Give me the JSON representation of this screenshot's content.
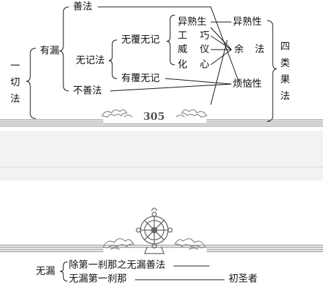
{
  "page_top": {
    "root_label": "一切法",
    "branches": {
      "good": "善法",
      "outflow": "有漏",
      "neutral": "无记法",
      "unobscured": "无覆无记",
      "obscured": "有覆无记",
      "unwholesome": "不善法"
    },
    "unobscured_items": [
      {
        "left": "异熟生",
        "right": ""
      },
      {
        "left": "工",
        "right": "巧"
      },
      {
        "left": "威",
        "right": "仪"
      },
      {
        "left": "化",
        "right": "心"
      }
    ],
    "results": {
      "ripened": "异熟性",
      "residual_left": "余",
      "residual_right": "法",
      "afflicted": "烦恼性"
    },
    "four_results_label": "四类果法",
    "page_number": "305"
  },
  "page_bottom": {
    "label": "无漏",
    "items": [
      {
        "text": "除第一刹那之无漏善法",
        "target": ""
      },
      {
        "text": "无漏第一刹那",
        "target": "初圣者"
      }
    ]
  },
  "colors": {
    "ink": "#111111",
    "gap": "#f2f2f2",
    "ornament": "#888888"
  },
  "icons": [
    "cloud-ornament-icon",
    "dharma-wheel-icon"
  ]
}
